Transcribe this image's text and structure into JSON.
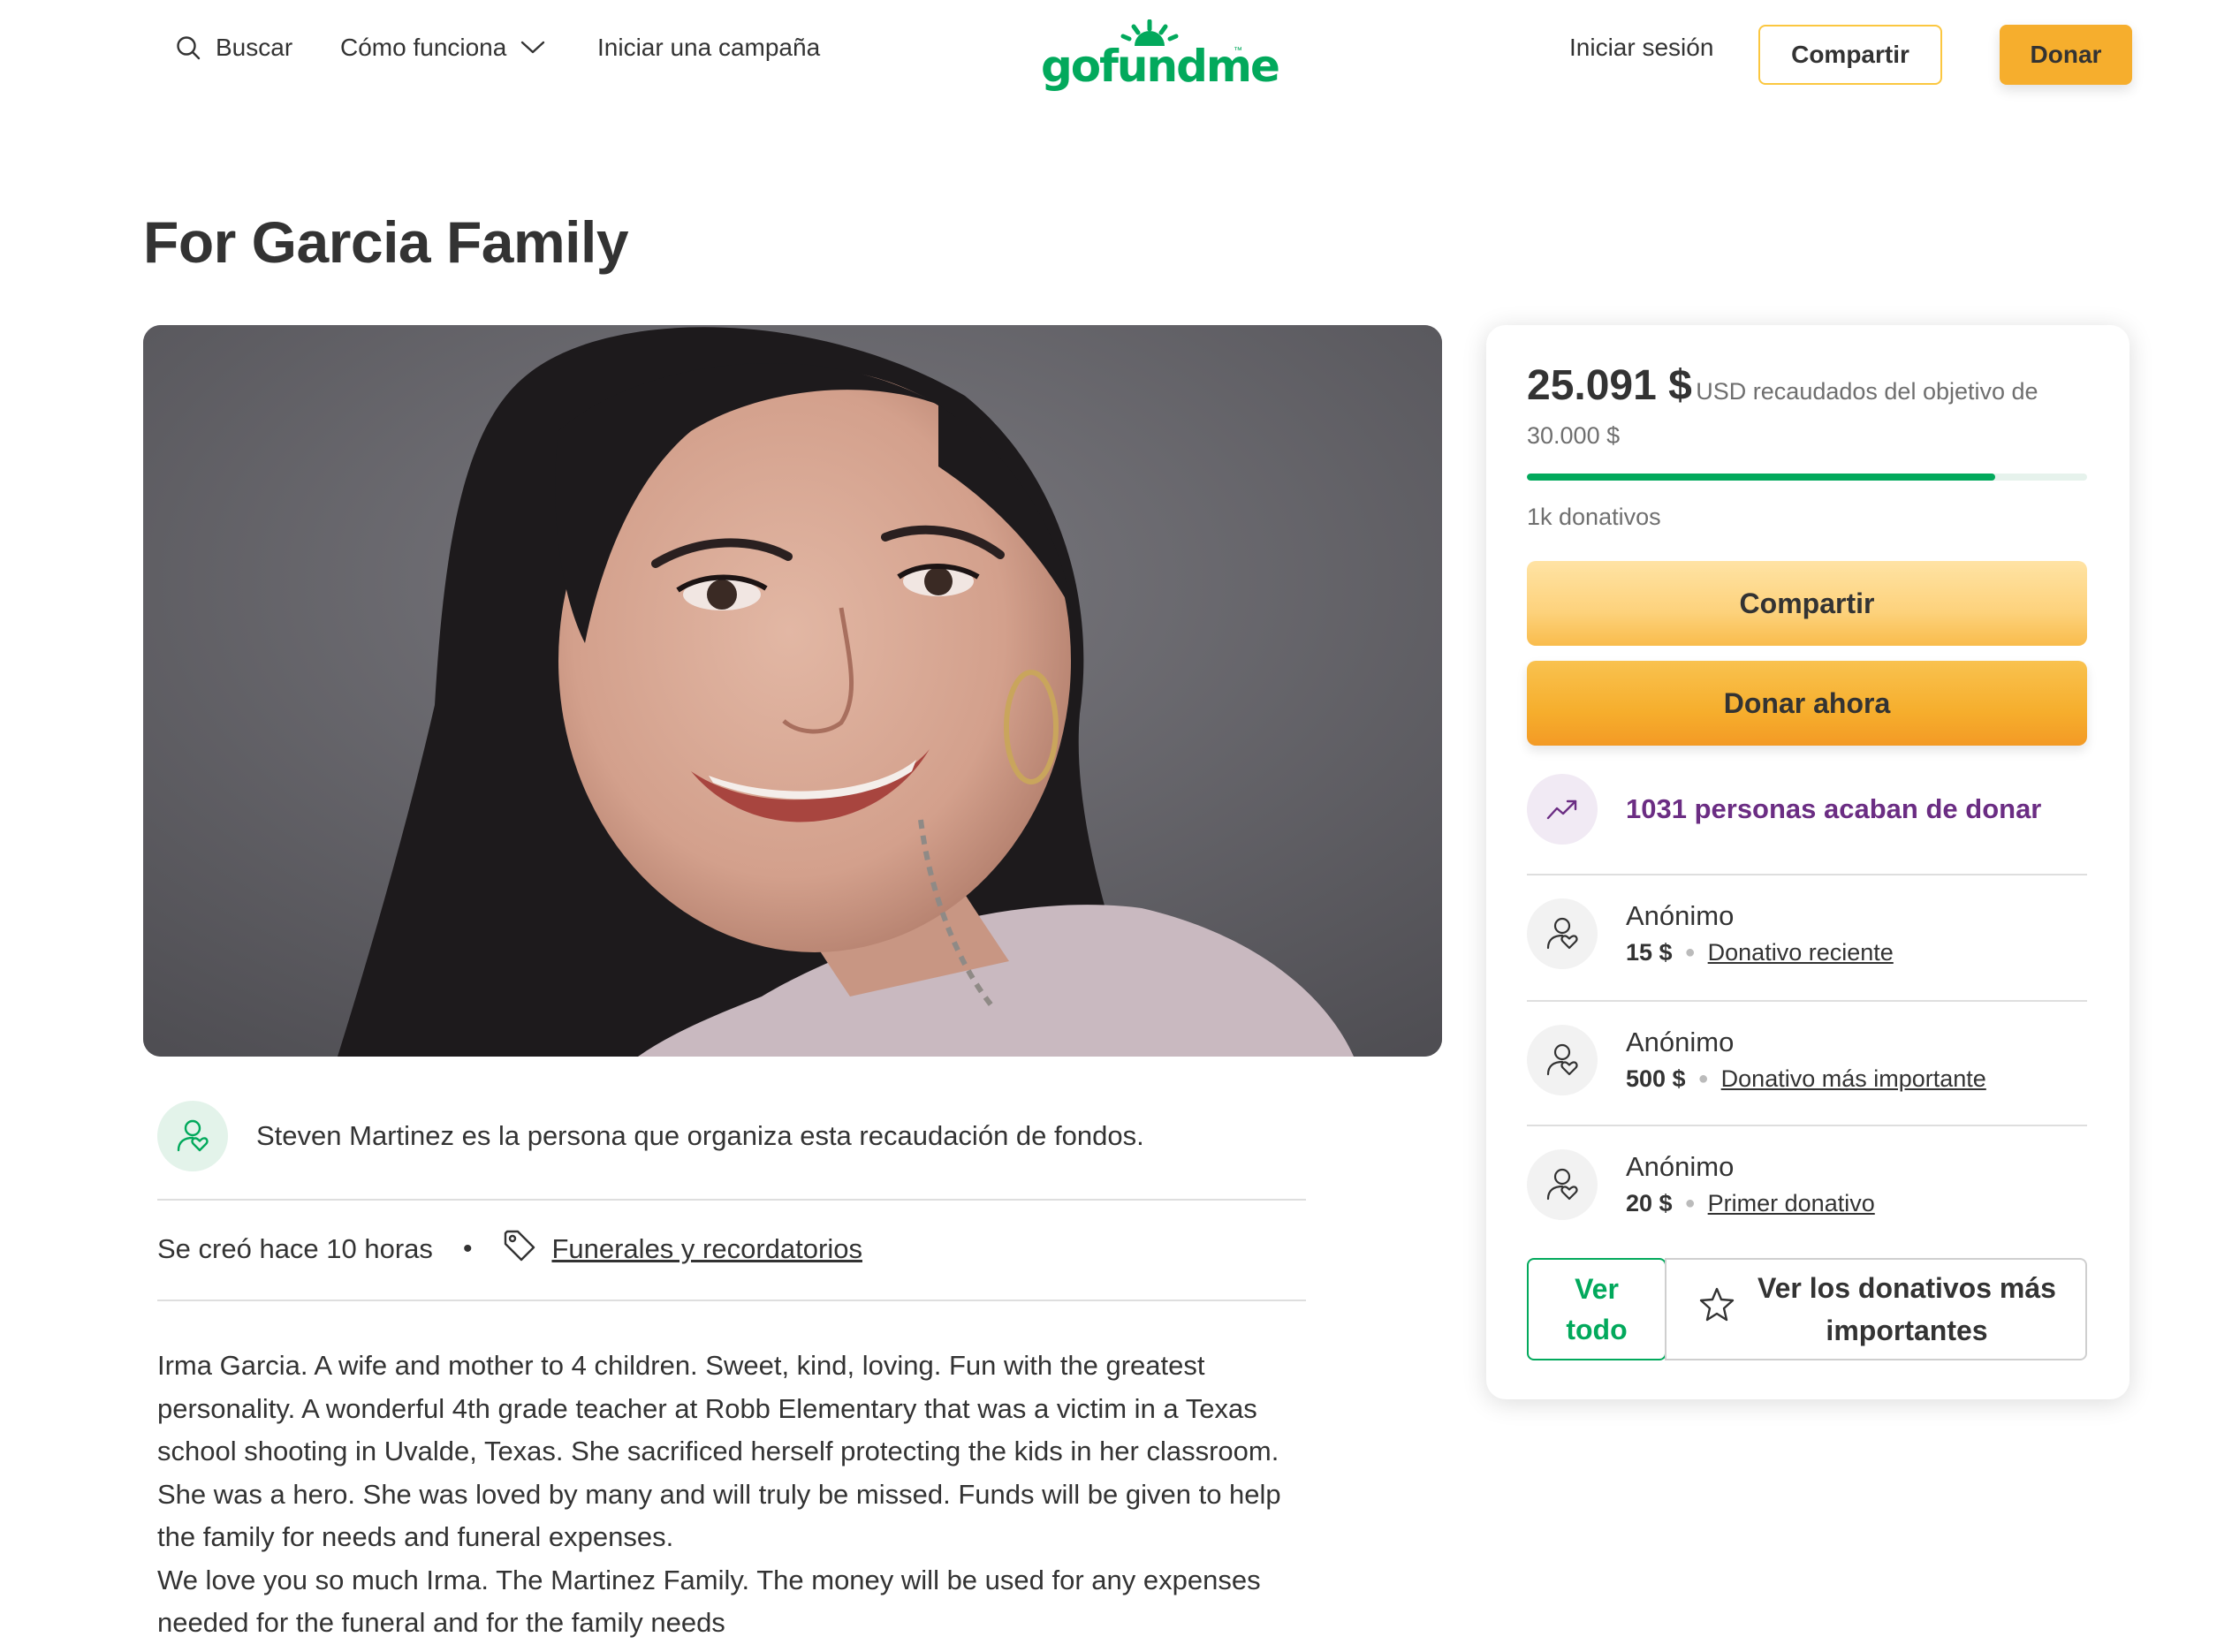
{
  "header": {
    "search_label": "Buscar",
    "how_it_works_label": "Cómo funciona",
    "start_campaign_label": "Iniciar una campaña",
    "logo_text": "gofundme",
    "login_label": "Iniciar sesión",
    "share_label": "Compartir",
    "donate_label": "Donar"
  },
  "campaign": {
    "title": "For Garcia Family",
    "organizer_text": "Steven Martinez es la persona que organiza esta recaudación de fondos.",
    "created_text": "Se creó hace 10 horas",
    "category_label": "Funerales y recordatorios",
    "story_paragraphs": [
      "Irma Garcia. A wife and mother to 4 children. Sweet, kind, loving. Fun with the greatest personality. A wonderful 4th grade teacher at Robb Elementary that was a victim in a Texas school shooting in Uvalde, Texas. She sacrificed herself protecting the kids in her classroom. She was a hero. She was loved by many and will truly be missed. Funds will be given to help the family for needs and funeral expenses.",
      "We love you so much Irma. The Martinez Family. The money will be used for any expenses needed for the funeral and for the family needs"
    ]
  },
  "donation_card": {
    "raised_amount": "25.091 $",
    "raised_suffix": "USD recaudados del objetivo de",
    "goal_amount": "30.000 $",
    "progress_fraction": 0.8364,
    "donations_count": "1k donativos",
    "share_button": "Compartir",
    "donate_button": "Donar ahora",
    "recent_activity": "1031 personas acaban de donar",
    "donors": [
      {
        "name": "Anónimo",
        "amount": "15 $",
        "tag": "Donativo reciente"
      },
      {
        "name": "Anónimo",
        "amount": "500 $",
        "tag": "Donativo más importante"
      },
      {
        "name": "Anónimo",
        "amount": "20 $",
        "tag": "Primer donativo"
      }
    ],
    "view_all_button": "Ver todo",
    "top_donations_button": "Ver los donativos más importantes"
  },
  "colors": {
    "brand_green": "#02a95c",
    "donate_yellow": "#f6ae2d",
    "share_yellow": "#fbc740",
    "activity_purple": "#6b2d83"
  },
  "icons": {
    "search": "search-icon",
    "dropdown": "chevron-down-icon",
    "organizer": "user-heart-icon",
    "category": "tag-icon",
    "trend": "trending-up-icon",
    "donor": "user-heart-icon",
    "star": "star-icon"
  }
}
